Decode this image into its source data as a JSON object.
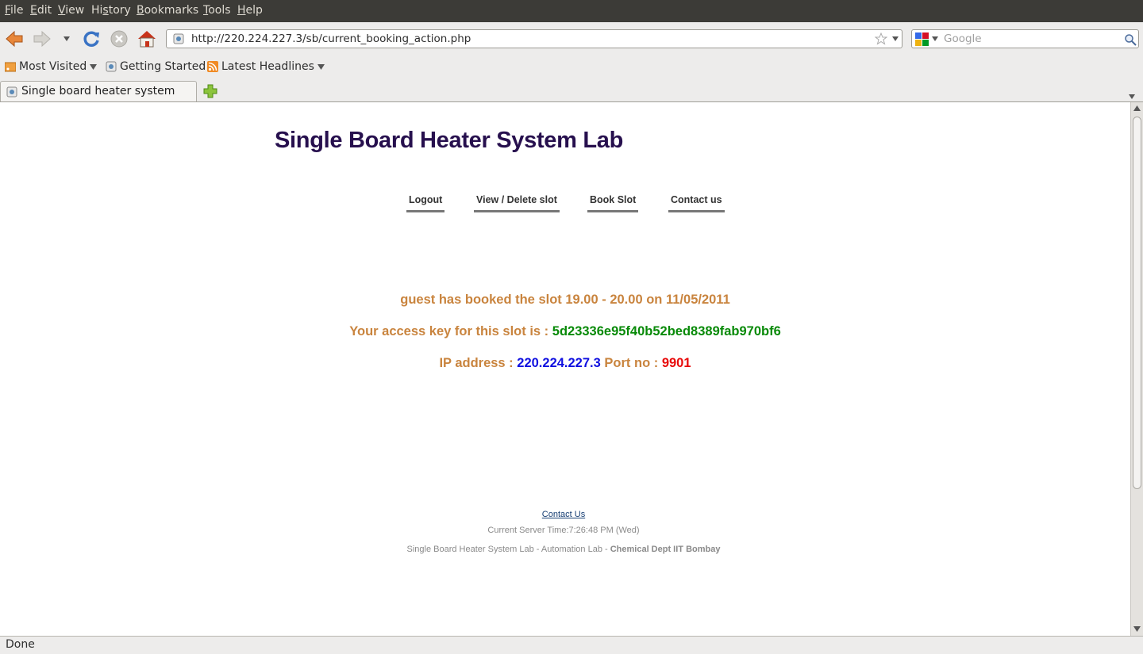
{
  "menubar": {
    "items": [
      {
        "pre": "",
        "key": "F",
        "post": "ile"
      },
      {
        "pre": "",
        "key": "E",
        "post": "dit"
      },
      {
        "pre": "",
        "key": "V",
        "post": "iew"
      },
      {
        "pre": "Hi",
        "key": "s",
        "post": "tory"
      },
      {
        "pre": "",
        "key": "B",
        "post": "ookmarks"
      },
      {
        "pre": "",
        "key": "T",
        "post": "ools"
      },
      {
        "pre": "",
        "key": "H",
        "post": "elp"
      }
    ]
  },
  "navbar": {
    "url": "http://220.224.227.3/sb/current_booking_action.php",
    "search_placeholder": "Google"
  },
  "bookmarks": [
    {
      "label": "Most Visited",
      "icon": "rss-folder-icon",
      "dropdown": true
    },
    {
      "label": "Getting Started",
      "icon": "page-icon",
      "dropdown": false
    },
    {
      "label": "Latest Headlines",
      "icon": "rss-feed-icon",
      "dropdown": true
    }
  ],
  "tab": {
    "title": "Single board heater system"
  },
  "page": {
    "site_title": "Single Board Heater System Lab",
    "nav": [
      "Logout",
      "View / Delete slot",
      "Book Slot",
      "Contact us"
    ],
    "booking": {
      "user": "guest",
      "booked_text": "has booked the slot",
      "slot": "19.00 - 20.00",
      "on_text": "on",
      "date": "11/05/2011",
      "key_label": "Your access key for this slot is :",
      "access_key": "5d23336e95f40b52bed8389fab970bf6",
      "ip_label": "IP address :",
      "ip": "220.224.227.3",
      "port_label": "Port no :",
      "port": "9901"
    },
    "footer": {
      "contact": "Contact Us",
      "server_time": "Current Server Time:7:26:48 PM (Wed)",
      "credit": "Single Board Heater System Lab - Automation Lab - ",
      "credit_bold": "Chemical Dept IIT Bombay"
    }
  },
  "status": {
    "text": "Done"
  },
  "colors": {
    "title": "#27104e",
    "message": "#c9843e",
    "key": "#088a08",
    "ip": "#1010e0",
    "port": "#e80a0a"
  }
}
